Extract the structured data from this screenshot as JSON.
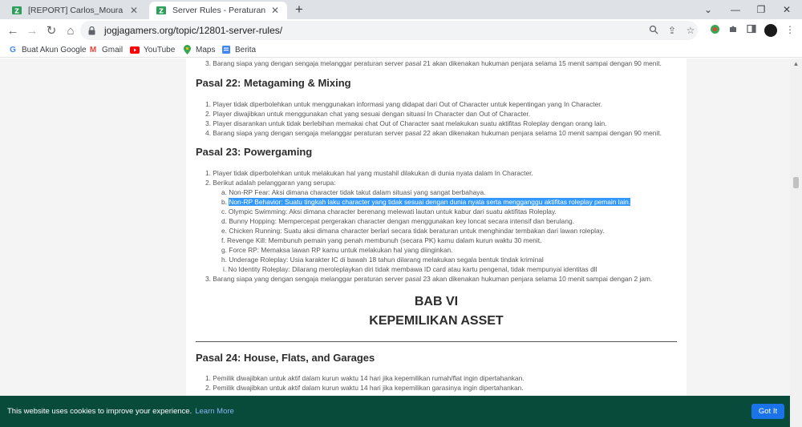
{
  "browser": {
    "tabs": [
      {
        "title": "[REPORT] Carlos_Moura & Nayla",
        "active": false
      },
      {
        "title": "Server Rules - Peraturan - Jogjag",
        "active": true
      }
    ],
    "new_tab_label": "+",
    "url": "jogjagamers.org/topic/12801-server-rules/",
    "bookmarks": [
      {
        "label": "Buat Akun Google",
        "icon": "google-icon"
      },
      {
        "label": "Gmail",
        "icon": "gmail-icon"
      },
      {
        "label": "YouTube",
        "icon": "youtube-icon"
      },
      {
        "label": "Maps",
        "icon": "maps-icon"
      },
      {
        "label": "Berita",
        "icon": "news-icon"
      }
    ]
  },
  "content": {
    "top_line": "3. Barang siapa yang dengan sengaja melanggar peraturan server pasal 21 akan dikenakan hukuman penjara selama 15 menit sampai dengan 90 menit.",
    "pasal22": {
      "title": "Pasal 22: Metagaming & Mixing",
      "items": [
        "1. Player tidak diperbolehkan untuk menggunakan informasi yang didapat dari Out of Character untuk kepentingan yang In Character.",
        "2. Player diwajibkan untuk menggunakan chat yang sesuai dengan situasi In Character dan Out of Character.",
        "3. Player disarankan untuk tidak berlebihan memakai chat Out of Character saat melakukan suatu aktifitas Roleplay dengan orang lain.",
        "4. Barang siapa yang dengan sengaja melanggar peraturan server pasal 22 akan dikenakan hukuman penjara selama 10 menit sampai dengan 90 menit."
      ]
    },
    "pasal23": {
      "title": "Pasal 23: Powergaming",
      "item1": "1. Player tidak diperbolehkan untuk melakukan hal yang mustahil dilakukan di dunia nyata dalam In Character.",
      "item2": "2. Berikut adalah pelanggaran yang serupa:",
      "subitems": [
        {
          "marker": "a.",
          "text": "Non-RP Fear: Aksi dimana character tidak takut dalam situasi yang sangat berbahaya."
        },
        {
          "marker": "b.",
          "text": "Non-RP Behavior: Suatu tingkah laku character yang tidak sesuai dengan dunia nyata serta mengganggu aktifitas roleplay pemain lain."
        },
        {
          "marker": "c.",
          "text": "Olympic Swimming: Aksi dimana character berenang melewati lautan untuk kabur dari suatu aktifitas Roleplay."
        },
        {
          "marker": "d.",
          "text": "Bunny Hopping: Mempercepat pergerakan character dengan menggunakan key loncat secara intensif dan berulang."
        },
        {
          "marker": "e.",
          "text": "Chicken Running: Suatu aksi dimana character berlari secara tidak beraturan untuk menghindar tembakan dari lawan roleplay."
        },
        {
          "marker": "f.",
          "text": "Revenge Kill: Membunuh pemain yang penah membunuh (secara PK) kamu dalam kurun waktu 30 menit."
        },
        {
          "marker": "g.",
          "text": "Force RP: Memaksa lawan RP kamu untuk melakukan hal yang diinginkan."
        },
        {
          "marker": "h.",
          "text": "Underage Roleplay: Usia karakter IC di bawah 18 tahun dilarang melakukan segala bentuk tindak kriminal"
        },
        {
          "marker": "i.",
          "text": "No Identity Roleplay: Dilarang meroleplaykan diri tidak membawa ID card atau kartu pengenal, tidak mempunyai identitas dll"
        }
      ],
      "item3": "3. Barang siapa yang dengan sengaja melanggar peraturan server pasal 23 akan dikenakan hukuman penjara selama 10 menit sampai dengan 2 jam."
    },
    "bab": {
      "line1": "BAB VI",
      "line2": "KEPEMILIKAN ASSET"
    },
    "pasal24": {
      "title": "Pasal 24: House, Flats, and Garages",
      "items": [
        "1. Pemilik diwajibkan untuk aktif dalam kurun waktu 14 hari jika kepemilikan rumah/flat ingin dipertahankan.",
        "2. Pemilik diwajibkan untuk aktif dalam kurun waktu 14 hari jika kepemilikan garasinya ingin dipertahankan."
      ]
    }
  },
  "cookie": {
    "text": "This website uses cookies to improve your experience.",
    "link": "Learn More",
    "button": "Got It"
  },
  "colors": {
    "cookie_bg": "#094b3b",
    "highlight": "#3399ff",
    "button": "#1a73e8"
  }
}
